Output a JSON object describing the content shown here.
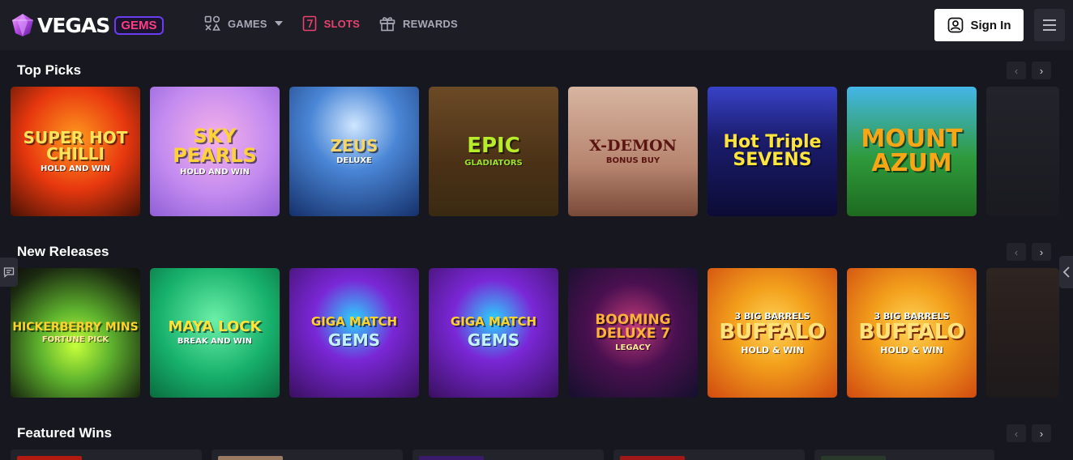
{
  "header": {
    "logo_text": "VEGAS",
    "logo_badge": "GEMS",
    "nav": [
      {
        "label": "GAMES",
        "icon": "games-grid-icon"
      },
      {
        "label": "SLOTS",
        "icon": "slot-seven-icon",
        "active": true
      },
      {
        "label": "REWARDS",
        "icon": "gift-icon"
      }
    ],
    "signin_label": "Sign In"
  },
  "sections": {
    "top_picks": {
      "title": "Top Picks",
      "prev": "‹",
      "next": "›",
      "tiles": [
        {
          "name": "SUPER HOT CHILLI",
          "sub": "HOLD AND WIN"
        },
        {
          "name": "SKY PEARLS",
          "sub": "HOLD AND WIN"
        },
        {
          "name": "ZEUS",
          "sub": "DELUXE"
        },
        {
          "name": "EPIC",
          "sub": "GLADIATORS"
        },
        {
          "name": "X-DEMON",
          "sub": "BONUS BUY"
        },
        {
          "name": "Hot Triple SEVENS",
          "sub": ""
        },
        {
          "name": "MOUNT AZUM",
          "sub": ""
        }
      ]
    },
    "new_releases": {
      "title": "New Releases",
      "prev": "‹",
      "next": "›",
      "tiles": [
        {
          "name": "HICKERBERRY MINS",
          "sub": "FORTUNE PICK"
        },
        {
          "name": "MAYA LOCK",
          "sub": "BREAK AND WIN"
        },
        {
          "name": "GIGA MATCH",
          "sub": "GEMS"
        },
        {
          "name": "GIGA MATCH",
          "sub": "GEMS"
        },
        {
          "name": "BOOMING DELUXE 7",
          "sub": "LEGACY"
        },
        {
          "name": "BUFFALO",
          "top": "3 BIG BARRELS",
          "sub": "HOLD & WIN"
        },
        {
          "name": "BUFFALO",
          "top": "3 BIG BARRELS",
          "sub": "HOLD & WIN"
        }
      ]
    },
    "featured_wins": {
      "title": "Featured Wins",
      "prev": "‹",
      "next": "›"
    }
  },
  "colors": {
    "background": "#17181f",
    "header": "#1c1d25",
    "active_nav": "#e6436f",
    "badge_border": "#6a3df0"
  }
}
